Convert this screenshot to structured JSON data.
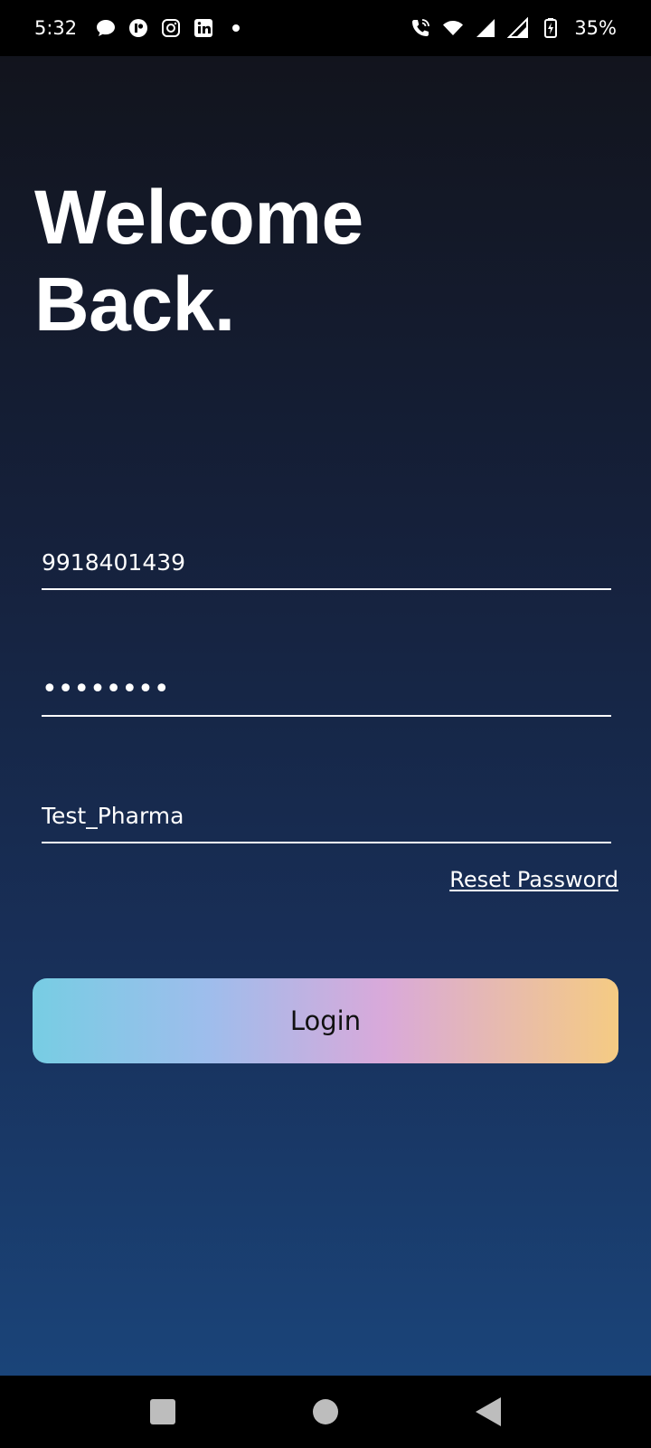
{
  "status_bar": {
    "time": "5:32",
    "left_icons": [
      "chat-bubble-icon",
      "app-icon",
      "instagram-icon",
      "linkedin-icon",
      "notification-dot-icon"
    ],
    "right_icons": [
      "wifi-calling-icon",
      "wifi-icon",
      "signal-icon",
      "signal-icon",
      "battery-charging-icon"
    ],
    "battery": "35%"
  },
  "heading": {
    "line1": "Welcome",
    "line2": "Back."
  },
  "form": {
    "phone_value": "9918401439",
    "password_mask": "••••••••",
    "company_value": "Test_Pharma",
    "reset_label": "Reset Password",
    "login_label": "Login"
  },
  "colors": {
    "background_top": "#12141d",
    "background_bottom": "#1a4479",
    "button_gradient": [
      "#77cde3",
      "#9ebdec",
      "#d9a9da",
      "#f5cb83"
    ]
  },
  "nav_bar": {
    "buttons": [
      "recents-button",
      "home-button",
      "back-button"
    ]
  }
}
